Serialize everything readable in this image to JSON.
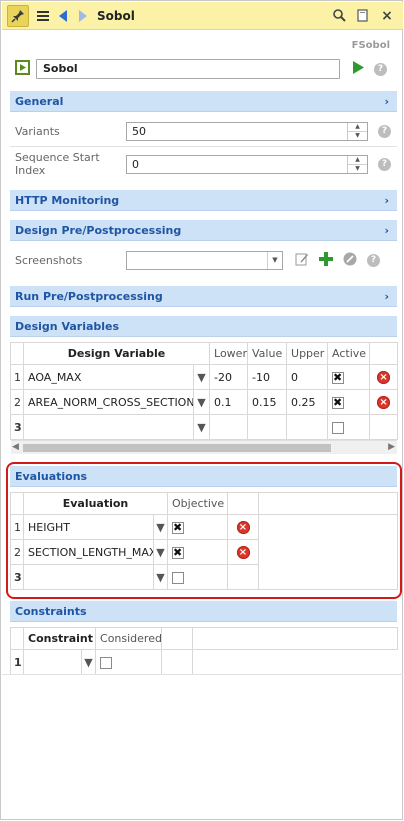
{
  "titlebar": {
    "title": "Sobol",
    "icons": [
      "pin-icon",
      "menu-icon",
      "back-arrow-icon",
      "forward-arrow-icon",
      "search-icon",
      "window-icon",
      "close-icon"
    ],
    "close_glyph": "×"
  },
  "header": {
    "type_label": "FSobol",
    "name_value": "Sobol"
  },
  "sections": {
    "general": "General",
    "http": "HTTP Monitoring",
    "design_pre": "Design Pre/Postprocessing",
    "run_pre": "Run Pre/Postprocessing",
    "design_vars": "Design Variables",
    "evaluations": "Evaluations",
    "constraints": "Constraints",
    "chevron": "›"
  },
  "general": {
    "variants_label": "Variants",
    "variants_value": "50",
    "seq_label": "Sequence Start Index",
    "seq_value": "0"
  },
  "design_pre": {
    "screenshots_label": "Screenshots",
    "screenshots_value": ""
  },
  "design_variables": {
    "headers": [
      "Design Variable",
      "Lower",
      "Value",
      "Upper",
      "Active"
    ],
    "rows": [
      {
        "n": "1",
        "name": "AOA_MAX",
        "lower": "-20",
        "value": "-10",
        "upper": "0",
        "active": true
      },
      {
        "n": "2",
        "name": "AREA_NORM_CROSS_SECTION",
        "lower": "0.1",
        "value": "0.15",
        "upper": "0.25",
        "active": true
      },
      {
        "n": "3",
        "name": "",
        "lower": "",
        "value": "",
        "upper": "",
        "active": false
      }
    ]
  },
  "evaluations": {
    "headers": [
      "Evaluation",
      "Objective"
    ],
    "rows": [
      {
        "n": "1",
        "name": "HEIGHT",
        "objective": true
      },
      {
        "n": "2",
        "name": "SECTION_LENGTH_MAX",
        "objective": true
      },
      {
        "n": "3",
        "name": "",
        "objective": false
      }
    ]
  },
  "constraints": {
    "headers": [
      "Constraint",
      "Considered"
    ],
    "rows": [
      {
        "n": "1",
        "name": "",
        "considered": false
      }
    ]
  },
  "colors": {
    "titlebar": "#fbf2a8",
    "section_bg": "#cde1f7",
    "section_text": "#1f56a3",
    "highlight": "#d21a1a",
    "run_green": "#2e9a2e"
  }
}
